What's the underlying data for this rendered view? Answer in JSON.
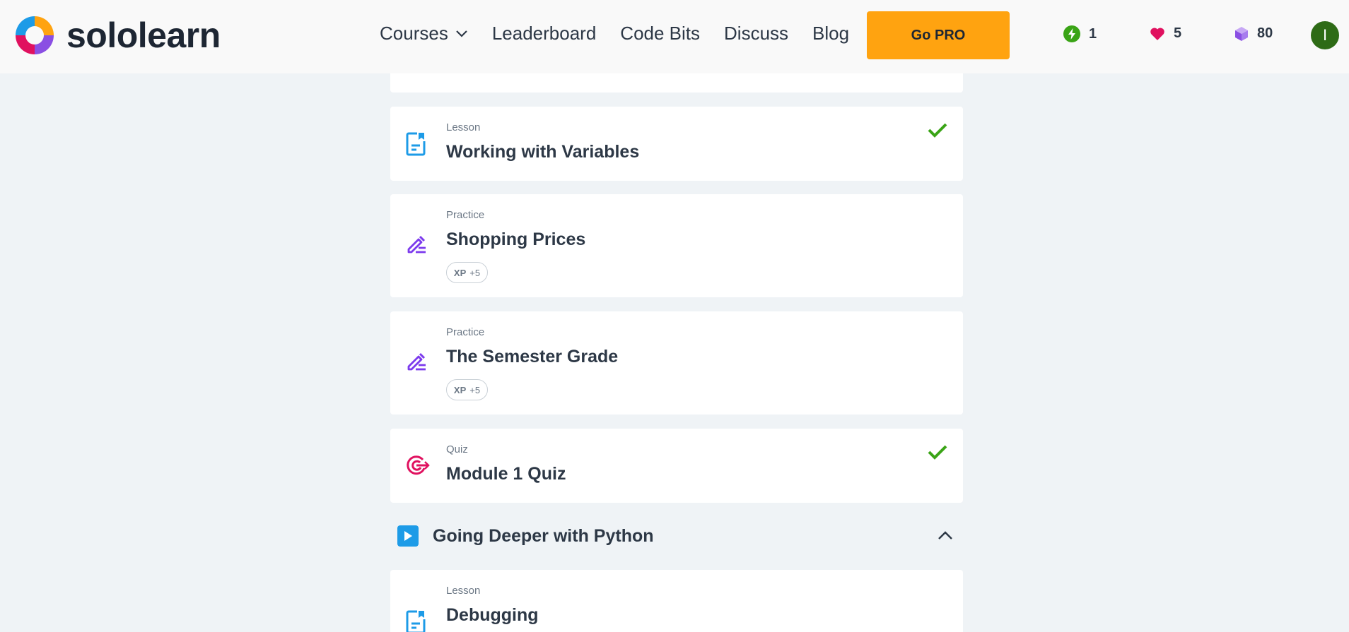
{
  "brand": {
    "name": "sololearn"
  },
  "nav": {
    "courses": "Courses",
    "leaderboard": "Leaderboard",
    "code_bits": "Code Bits",
    "discuss": "Discuss",
    "blog": "Blog",
    "go_pro": "Go PRO"
  },
  "stats": {
    "streak": "1",
    "hearts": "5",
    "bits": "80"
  },
  "user": {
    "avatar_initial": "I"
  },
  "items": [
    {
      "kind": "Lesson",
      "title": "Working with Variables",
      "completed": true,
      "icon": "lesson-icon"
    },
    {
      "kind": "Practice",
      "title": "Shopping Prices",
      "xp_label": "XP",
      "xp_value": "+5",
      "icon": "practice-icon"
    },
    {
      "kind": "Practice",
      "title": "The Semester Grade",
      "xp_label": "XP",
      "xp_value": "+5",
      "icon": "practice-icon"
    },
    {
      "kind": "Quiz",
      "title": "Module 1 Quiz",
      "completed": true,
      "icon": "quiz-icon"
    }
  ],
  "module": {
    "title": "Going Deeper with Python"
  },
  "next_item": {
    "kind": "Lesson",
    "title": "Debugging",
    "icon": "lesson-icon"
  },
  "colors": {
    "accent_orange": "#ffa310",
    "lesson_blue": "#1d9be7",
    "practice_purple": "#7c3aed",
    "quiz_pink": "#e0115f",
    "check_green": "#3aa416",
    "avatar_green": "#2e6b16"
  }
}
